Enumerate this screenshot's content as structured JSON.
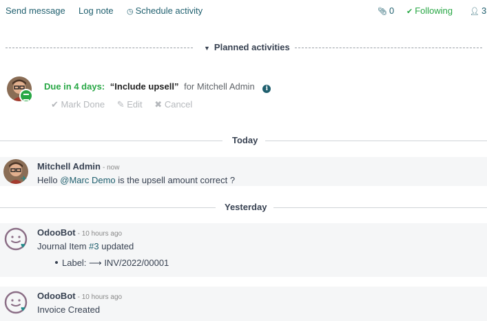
{
  "toolbar": {
    "send_message": "Send message",
    "log_note": "Log note",
    "schedule_activity": "Schedule activity",
    "attachments_count": "0",
    "following": "Following",
    "followers_count": "3"
  },
  "planned": {
    "label": "Planned activities",
    "activity": {
      "due": "Due in 4 days:",
      "summary": "“Include upsell”",
      "for": "for Mitchell Admin",
      "mark_done": "Mark Done",
      "edit": "Edit",
      "cancel": "Cancel"
    }
  },
  "separators": {
    "today": "Today",
    "yesterday": "Yesterday"
  },
  "messages": [
    {
      "author": "Mitchell Admin",
      "date": "- now",
      "body_prefix": "Hello ",
      "mention": "@Marc Demo",
      "body_suffix": " is the upsell amount correct ?"
    },
    {
      "author": "OdooBot",
      "date": "- 10 hours ago",
      "body_prefix": "Journal Item ",
      "ref": "#3",
      "body_suffix": " updated",
      "tracking_label": "Label:",
      "tracking_arrow": "⟶",
      "tracking_value": "INV/2022/00001"
    },
    {
      "author": "OdooBot",
      "date": "- 10 hours ago",
      "body": "Invoice Created"
    }
  ],
  "colors": {
    "accent": "#1f5f6e",
    "success": "#28a745"
  }
}
